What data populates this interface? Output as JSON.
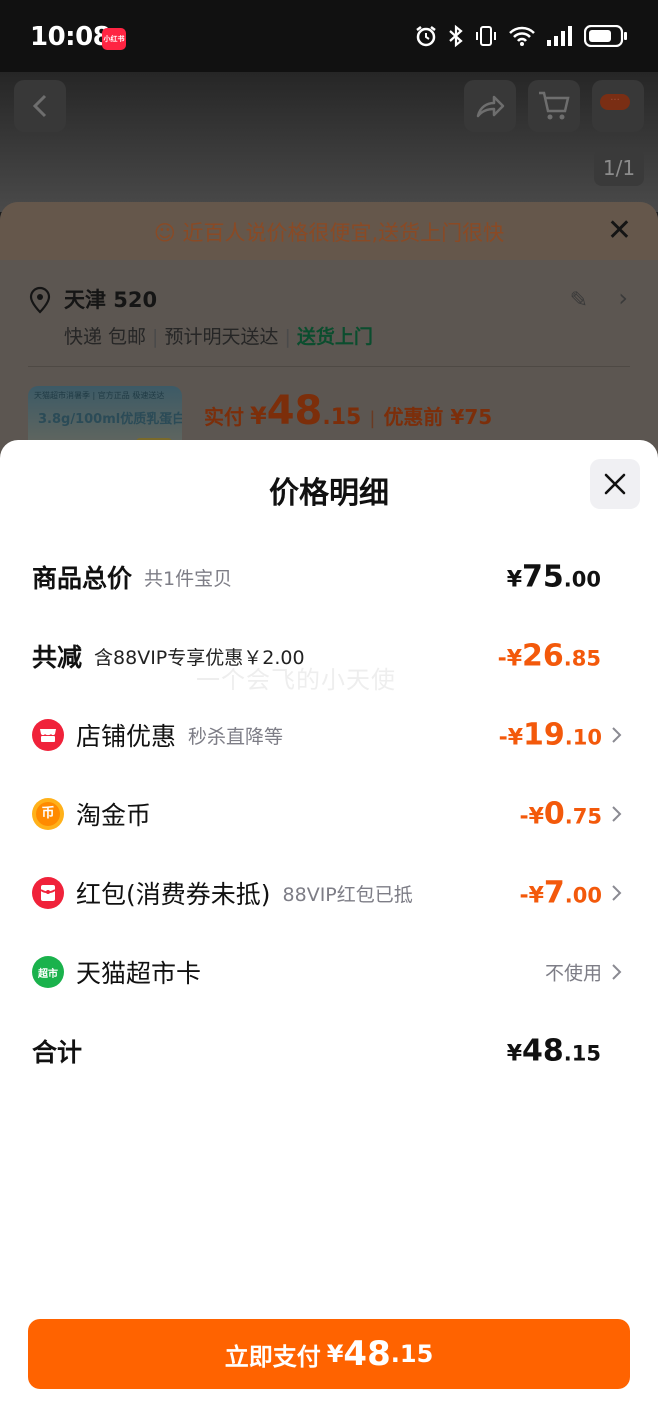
{
  "status_bar": {
    "time": "10:08",
    "app_badge": "小红书"
  },
  "background_page": {
    "pager": "1/1",
    "tip": "近百人说价格很便宜,送货上门很快",
    "address": {
      "city": "天津 520",
      "shipping": "快递 包邮",
      "eta": "预计明天送达",
      "delivery_tag": "送货上门"
    },
    "product": {
      "banner": "天猫超市消暑季 | 官方正品 极速送达",
      "label": "3.8g/100ml优质乳蛋白",
      "price_label": "实付",
      "price_symbol": "¥",
      "price_int": "48",
      "price_dec": ".15",
      "orig_label": "优惠前 ¥75"
    }
  },
  "sheet": {
    "title": "价格明细",
    "watermark": "一个会飞的小天使",
    "rows": [
      {
        "label": "商品总价",
        "note": "共1件宝贝",
        "sign": "¥",
        "int": "75",
        "dec": ".00"
      },
      {
        "label": "共减",
        "note": "含88VIP专享优惠￥2.00",
        "sign": "-¥",
        "int": "26",
        "dec": ".85"
      },
      {
        "label": "店铺优惠",
        "note": "秒杀直降等",
        "sign": "-¥",
        "int": "19",
        "dec": ".10"
      },
      {
        "label": "淘金币",
        "note": "",
        "sign": "-¥",
        "int": "0",
        "dec": ".75"
      },
      {
        "label": "红包(消费券未抵)",
        "note": "88VIP红包已抵",
        "sign": "-¥",
        "int": "7",
        "dec": ".00"
      },
      {
        "label": "天猫超市卡",
        "note": "",
        "value": "不使用"
      },
      {
        "label": "合计",
        "note": "",
        "sign": "¥",
        "int": "48",
        "dec": ".15"
      }
    ],
    "icon_text": {
      "coin": "币",
      "card": "超市"
    },
    "pay_button": {
      "label": "立即支付",
      "sign": "¥",
      "int": "48",
      "dec": ".15"
    }
  },
  "colors": {
    "accent_orange": "#ff6300",
    "discount_orange": "#f3590b",
    "text_dark": "#111111",
    "text_gray": "#7d7d86"
  }
}
